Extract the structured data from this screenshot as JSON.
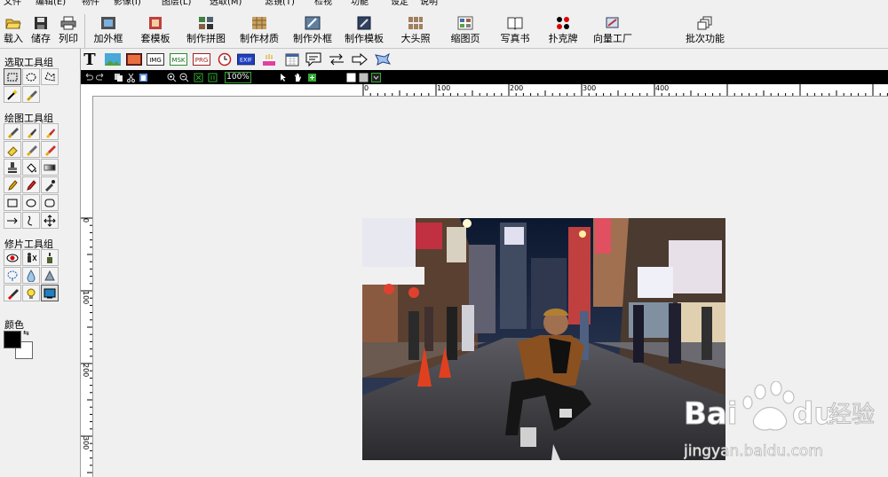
{
  "menu": [
    "文件",
    "编辑(E)",
    "物件",
    "影像(I)",
    "图层(L)",
    "选取(M)",
    "滤镜(T)",
    "检视",
    "功能",
    "设定",
    "说明"
  ],
  "toolbar": {
    "load": "载入",
    "save": "储存",
    "print": "列印",
    "add_frame": "加外框",
    "template_set": "套模板",
    "make_collage": "制作拼图",
    "make_material": "制作材质",
    "make_frame": "制作外框",
    "make_template": "制作模板",
    "big_head": "大头照",
    "thumbnail_page": "缩图页",
    "photo_book": "写真书",
    "poker": "扑克牌",
    "vector_factory": "向量工厂",
    "batch": "批次功能"
  },
  "left": {
    "select_group": "选取工具组",
    "draw_group": "绘图工具组",
    "retouch_group": "修片工具组",
    "color_label": "颜色"
  },
  "secondary": {
    "text_tool": "T",
    "img_badge": "IMG",
    "msk_badge": "MSK",
    "prg_badge": "PRG",
    "exif_badge": "EXIF"
  },
  "zoom": "100%",
  "ruler_h": [
    "0",
    "100",
    "200",
    "300",
    "400"
  ],
  "ruler_v": [
    "0",
    "100",
    "200",
    "300"
  ],
  "watermark": {
    "brand": "Bai",
    "brand2": "du",
    "cn": "经验",
    "url": "jingyan.baidu.com"
  },
  "colors": {
    "foreground": "#000000",
    "background": "#ffffff"
  }
}
